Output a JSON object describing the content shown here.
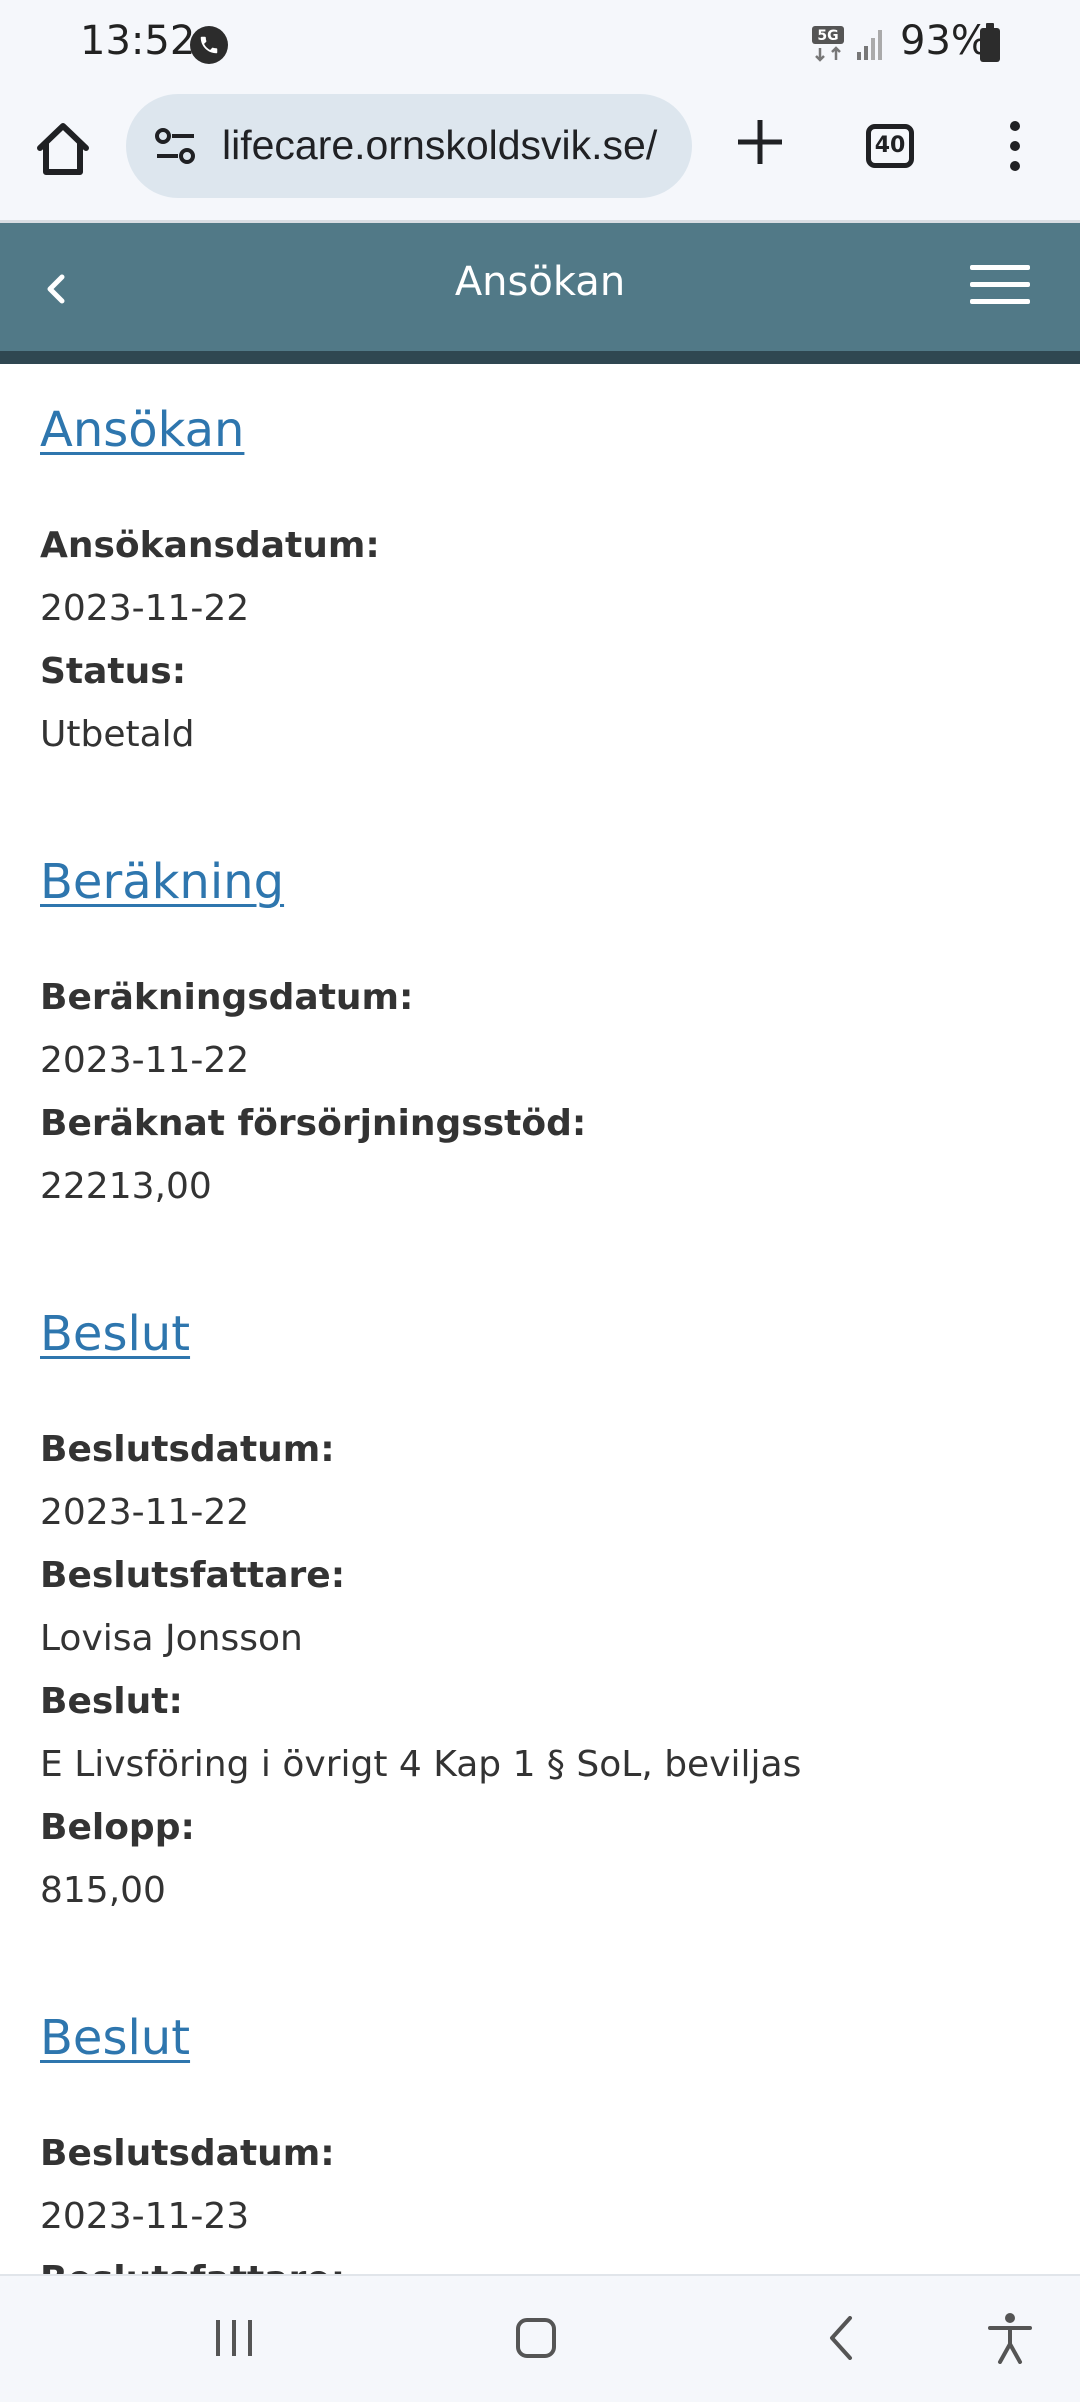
{
  "status_bar": {
    "time": "13:52",
    "network": "5G",
    "battery": "93%"
  },
  "browser": {
    "url": "lifecare.ornskoldsvik.se/",
    "tab_count": "40"
  },
  "header": {
    "title": "Ansökan"
  },
  "sections": [
    {
      "title": "Ansökan",
      "fields": [
        {
          "label": "Ansökansdatum:",
          "value": "2023-11-22"
        },
        {
          "label": "Status:",
          "value": "Utbetald"
        }
      ]
    },
    {
      "title": "Beräkning",
      "fields": [
        {
          "label": "Beräkningsdatum:",
          "value": "2023-11-22"
        },
        {
          "label": "Beräknat försörjningsstöd:",
          "value": "22213,00"
        }
      ]
    },
    {
      "title": "Beslut",
      "fields": [
        {
          "label": "Beslutsdatum:",
          "value": "2023-11-22"
        },
        {
          "label": "Beslutsfattare:",
          "value": "Lovisa Jonsson"
        },
        {
          "label": "Beslut:",
          "value": "E Livsföring i övrigt 4 Kap 1 § SoL, beviljas"
        },
        {
          "label": "Belopp:",
          "value": "815,00"
        }
      ]
    },
    {
      "title": "Beslut",
      "fields": [
        {
          "label": "Beslutsdatum:",
          "value": "2023-11-23"
        },
        {
          "label": "Beslutsfattare:",
          "value": ""
        }
      ]
    }
  ],
  "colors": {
    "header_bg": "#517987",
    "link": "#2e76ae",
    "text": "#333333"
  },
  "icons": {
    "home": "home-icon",
    "site_settings": "tune-icon",
    "new_tab": "plus-icon",
    "menu": "more-vert-icon",
    "back": "chevron-left-icon",
    "hamburger": "hamburger-icon"
  }
}
